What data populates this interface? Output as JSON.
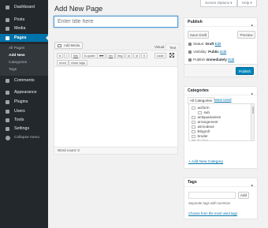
{
  "sidebar": {
    "items": [
      {
        "label": "Dashboard",
        "icon": "dashboard-icon"
      },
      {
        "label": "Posts",
        "icon": "pin-icon"
      },
      {
        "label": "Media",
        "icon": "media-icon"
      },
      {
        "label": "Pages",
        "icon": "page-icon"
      },
      {
        "label": "Comments",
        "icon": "comment-icon"
      },
      {
        "label": "Appearance",
        "icon": "brush-icon"
      },
      {
        "label": "Plugins",
        "icon": "plugin-icon"
      },
      {
        "label": "Users",
        "icon": "user-icon"
      },
      {
        "label": "Tools",
        "icon": "wrench-icon"
      },
      {
        "label": "Settings",
        "icon": "settings-icon"
      },
      {
        "label": "Collapse menu",
        "icon": "collapse-icon"
      }
    ],
    "submenu": [
      "All Pages",
      "Add New",
      "Categories",
      "Tags"
    ],
    "accent": "#0073aa"
  },
  "header": {
    "screen_options": "Screen Options ▾",
    "help": "Help ▾",
    "title": "Add New Page"
  },
  "editor": {
    "title_placeholder": "Enter title here",
    "add_media": "Add Media",
    "tab_visual": "Visual",
    "tab_text": "Text",
    "quicktags_row1": [
      "b",
      "i",
      "link",
      "b-quote",
      "del",
      "ins",
      "img",
      "ul",
      "ol",
      "li",
      "code"
    ],
    "quicktags_row2": [
      "more",
      "close tags"
    ],
    "word_count": "Word count: 0"
  },
  "publish": {
    "title": "Publish",
    "save_draft": "Save Draft",
    "preview": "Preview",
    "status_label": "Status:",
    "status_value": "Draft",
    "visibility_label": "Visibility:",
    "visibility_value": "Public",
    "schedule_label": "Publish",
    "schedule_value": "immediately",
    "edit": "Edit",
    "publish_button": "Publish"
  },
  "categories": {
    "title": "Categories",
    "tab_all": "All Categories",
    "tab_most_used": "Most Used",
    "items": [
      {
        "label": "aciform",
        "indent": 0
      },
      {
        "label": "sub",
        "indent": 1
      },
      {
        "label": "antiquarianism",
        "indent": 0
      },
      {
        "label": "arrangement",
        "indent": 0
      },
      {
        "label": "asmodeus",
        "indent": 0
      },
      {
        "label": "Blogroll",
        "indent": 0
      },
      {
        "label": "broder",
        "indent": 0
      },
      {
        "label": "buying",
        "indent": 0
      }
    ],
    "add_new": "+ Add New Category"
  },
  "tags": {
    "title": "Tags",
    "add_button": "Add",
    "hint": "Separate tags with commas",
    "choose": "Choose from the most used tags"
  }
}
